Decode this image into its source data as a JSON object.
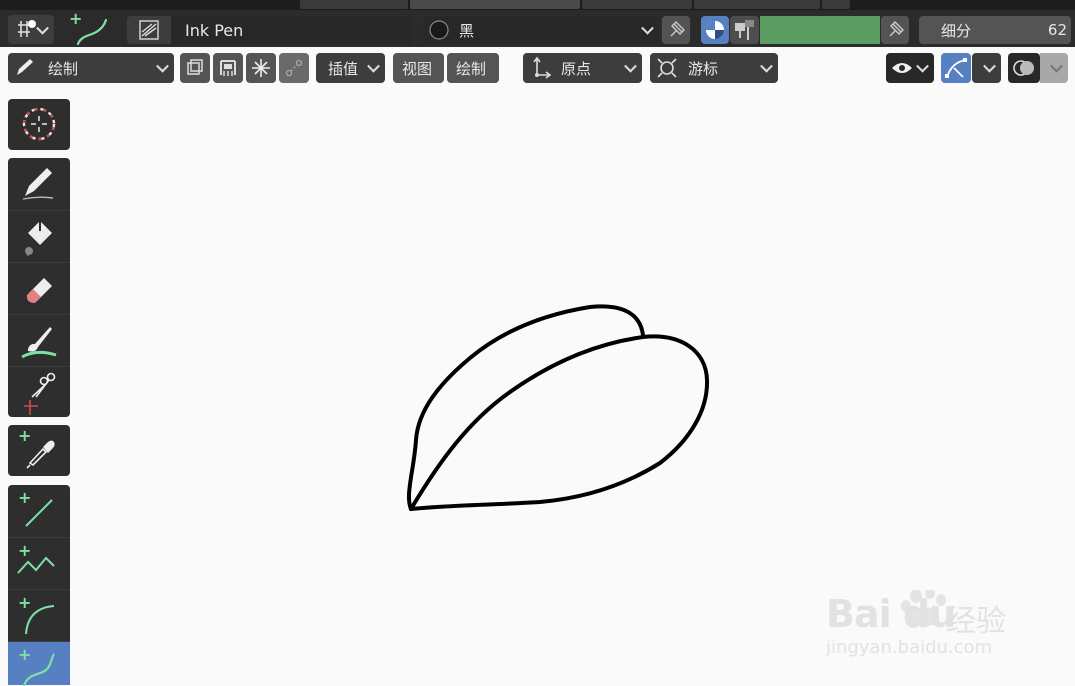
{
  "topbar": {
    "brush_name": "Ink Pen",
    "material_name": "黑",
    "subdivision_label": "细分",
    "subdivision_value": "62",
    "color_swatch": "#5a9c61"
  },
  "toolbar": {
    "mode_label": "绘制",
    "interpolate_label": "插值",
    "view_label": "视图",
    "draw_label": "绘制",
    "origin_label": "原点",
    "cursor_label": "游标"
  },
  "tools": [
    {
      "name": "cursor"
    },
    {
      "name": "draw"
    },
    {
      "name": "fill"
    },
    {
      "name": "erase"
    },
    {
      "name": "tint"
    },
    {
      "name": "cutter"
    },
    {
      "name": "eyedropper"
    },
    {
      "name": "line"
    },
    {
      "name": "polyline"
    },
    {
      "name": "arc"
    },
    {
      "name": "curve"
    }
  ],
  "watermark": {
    "brand": "Bai du",
    "brand_cn": "经验",
    "url": "jingyan.baidu.com"
  },
  "colors": {
    "accent": "#5680c2",
    "panel": "#2e2e2e",
    "stroke": "#000000",
    "green_icon": "#7fe0a6"
  }
}
